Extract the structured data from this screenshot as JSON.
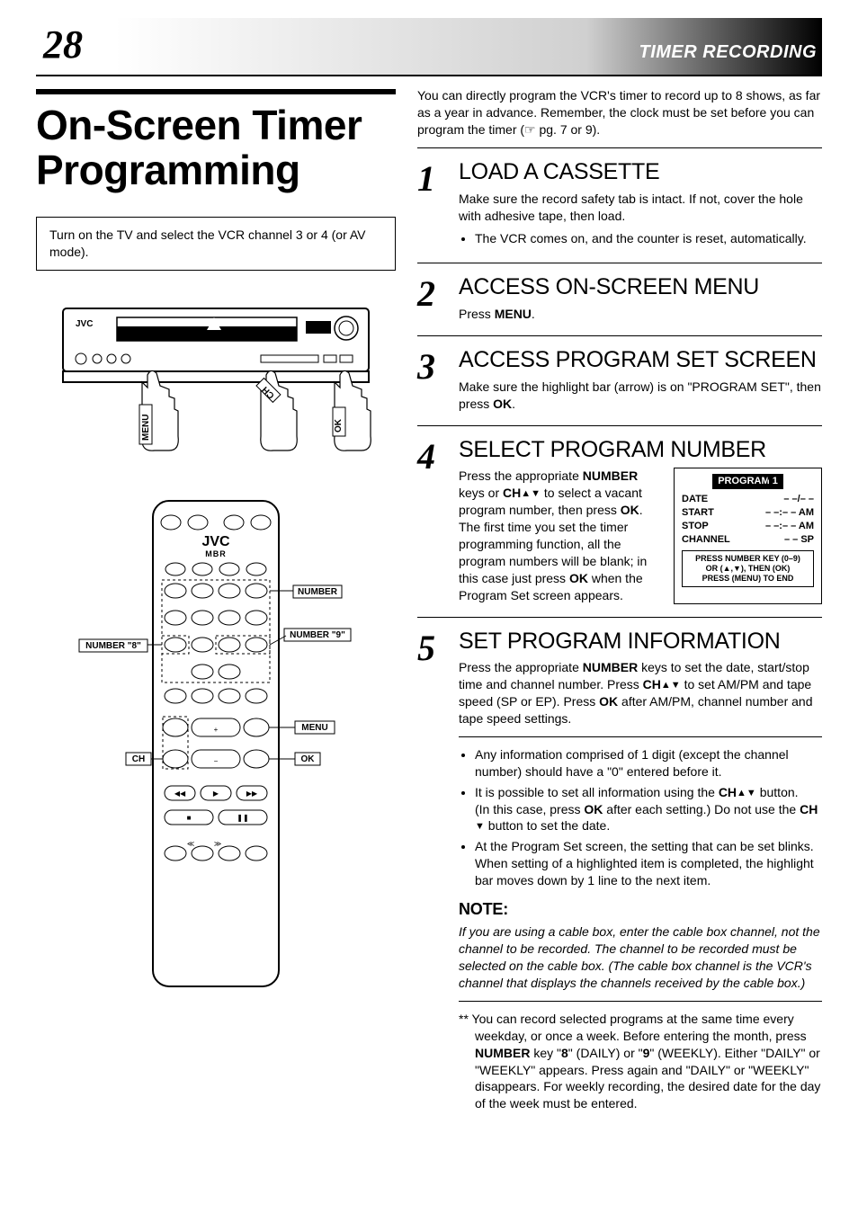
{
  "header": {
    "page_number": "28",
    "section": "TIMER RECORDING"
  },
  "main_title": "On-Screen Timer Programming",
  "intro_box": "Turn on the TV and select the VCR channel 3 or 4 (or AV mode).",
  "vcr_labels": {
    "menu": "MENU",
    "ch": "CH",
    "ok": "OK",
    "brand": "JVC"
  },
  "remote_labels": {
    "brand": "JVC",
    "mbr": "MBR",
    "number": "NUMBER",
    "number9": "NUMBER \"9\"",
    "number8": "NUMBER \"8\"",
    "menu": "MENU",
    "ch": "CH",
    "ok": "OK"
  },
  "right_intro": "You can directly program the VCR's timer to record up to 8 shows, as far as a year in advance. Remember, the clock must be set before you can program the timer (☞ pg. 7 or 9).",
  "steps": [
    {
      "num": "1",
      "title": "LOAD A CASSETTE",
      "body": "Make sure the record safety tab is intact. If not, cover the hole with adhesive tape, then load.",
      "bullets": [
        "The VCR comes on, and the counter is reset, automatically."
      ]
    },
    {
      "num": "2",
      "title": "ACCESS ON-SCREEN MENU",
      "body_pre": "Press ",
      "body_bold": "MENU",
      "body_post": "."
    },
    {
      "num": "3",
      "title": "ACCESS PROGRAM SET SCREEN",
      "body_pre": "Make sure the highlight bar (arrow) is on  \"PROGRAM SET\", then press ",
      "body_bold": "OK",
      "body_post": "."
    },
    {
      "num": "4",
      "title": "SELECT PROGRAM NUMBER",
      "body4_pre": "Press the appropriate ",
      "body4_b1": "NUMBER",
      "body4_mid1": " keys or ",
      "body4_b2": "CH",
      "body4_arrows": "▲▼",
      "body4_mid2": " to select a vacant program number, then press ",
      "body4_b3": "OK",
      "body4_mid3": ". The first time you set the timer programming function, all the program numbers will be blank; in this case just press ",
      "body4_b4": "OK",
      "body4_post": " when the Program Set screen appears.",
      "osd": {
        "program": "PROGRAM 1",
        "rows": [
          {
            "k": "DATE",
            "v": "– –/– –"
          },
          {
            "k": "START",
            "v": "– –:– – AM"
          },
          {
            "k": "STOP",
            "v": "– –:– – AM"
          },
          {
            "k": "CHANNEL",
            "v": "– – SP"
          }
        ],
        "hint1": "PRESS NUMBER KEY (0–9)",
        "hint2": "OR (▲,▼), THEN (OK)",
        "hint3": "PRESS (MENU) TO END"
      }
    },
    {
      "num": "5",
      "title": "SET PROGRAM INFORMATION",
      "body5_pre": "Press the appropriate ",
      "body5_b1": "NUMBER",
      "body5_mid1": " keys to set the date, start/stop time and channel number. Press ",
      "body5_b2": "CH",
      "body5_arrows": "▲▼",
      "body5_mid2": " to set AM/PM and tape speed (SP or EP). Press ",
      "body5_b3": "OK",
      "body5_post": " after AM/PM, channel number and tape speed settings.",
      "bullets5": [
        {
          "t1": "Any information comprised of 1 digit (except the channel number) should have a \"0\" entered before it."
        },
        {
          "t1_pre": "It is possible to set all information using the ",
          "t1_b": "CH",
          "t1_arr": "▲▼",
          "t1_mid": " button.\n(In this case, press ",
          "t1_b2": "OK",
          "t1_mid2": " after each setting.) Do not use the ",
          "t1_b3": "CH",
          "t1_arr2": " ▼",
          "t1_post": " button to set the date."
        },
        {
          "t1": "At the Program Set screen, the setting that can be set blinks. When setting of a highlighted item is completed, the highlight bar moves down by 1 line to the next item."
        }
      ]
    }
  ],
  "note": {
    "heading": "NOTE:",
    "body": "If you are using a cable box, enter the cable box channel, not the channel to be recorded. The channel to be recorded must be selected on the cable box. (The cable box channel is the VCR's channel that displays the channels received by the cable box.)"
  },
  "footnote_pre": "** You can record selected programs at the same time every weekday, or once a week. Before entering the month, press ",
  "footnote_b1": "NUMBER",
  "footnote_mid1": " key \"",
  "footnote_b2": "8",
  "footnote_mid2": "\" (DAILY) or \"",
  "footnote_b3": "9",
  "footnote_post": "\" (WEEKLY). Either \"DAILY\" or \"WEEKLY\" appears. Press again and \"DAILY\" or \"WEEKLY\" disappears. For weekly recording, the desired date for the day of the week must be entered."
}
